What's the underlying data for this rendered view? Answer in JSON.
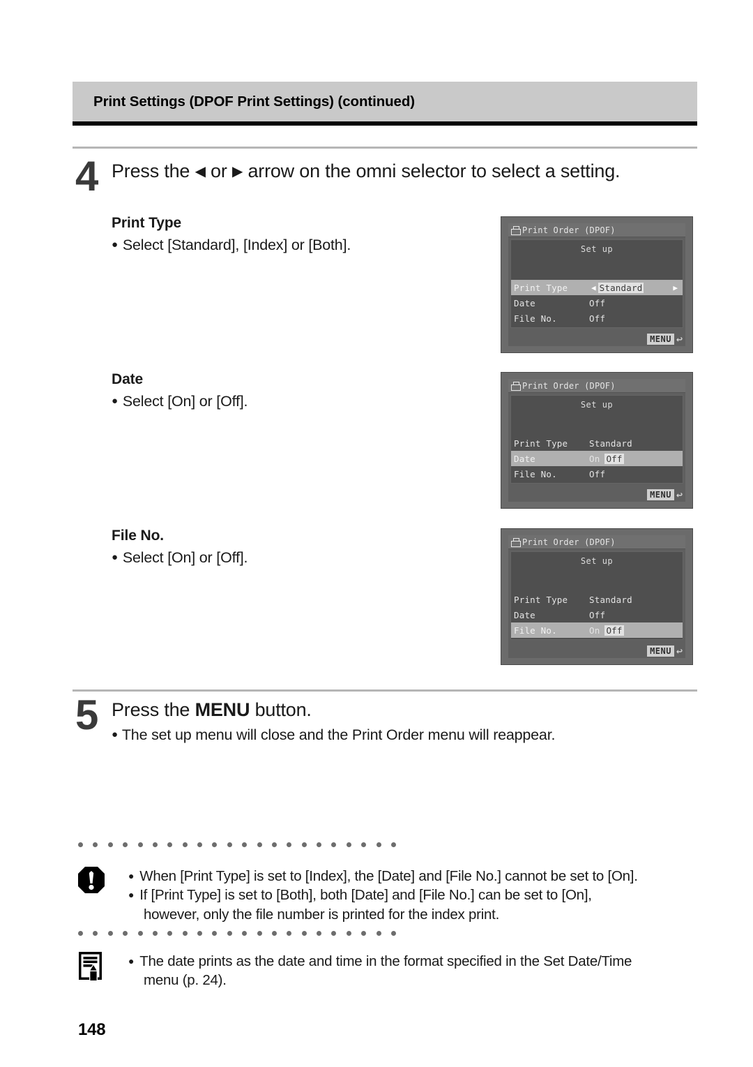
{
  "header": {
    "title": "Print Settings (DPOF Print Settings) (continued)"
  },
  "steps": [
    {
      "number": "4",
      "title_part1": "Press the ",
      "arrow_left": "◀",
      "title_part2": " or ",
      "arrow_right": "▶",
      "title_part3": " arrow on the omni selector to select a setting."
    },
    {
      "number": "5",
      "title_part1": "Press the ",
      "bold_word": "MENU",
      "title_part2": " button.",
      "bullet": "The set up menu will close and the Print Order menu will reappear."
    }
  ],
  "settings": [
    {
      "name": "Print Type",
      "desc": "Select [Standard], [Index] or [Both]."
    },
    {
      "name": "Date",
      "desc": "Select [On] or [Off]."
    },
    {
      "name": "File No.",
      "desc": "Select [On] or [Off]."
    }
  ],
  "lcd_screens": [
    {
      "title": "Print Order (DPOF)",
      "setup_label": "Set up",
      "menu_badge": "MENU",
      "return_glyph": "↩",
      "rows": [
        {
          "label": "Print Type",
          "value": "Standard",
          "selected": true,
          "show_arrows": true,
          "value_boxed": true,
          "arrow_left": "◀",
          "arrow_right": "▶"
        },
        {
          "label": "Date",
          "value": "Off",
          "selected": false,
          "show_arrows": false,
          "value_boxed": false
        },
        {
          "label": "File No.",
          "value": "Off",
          "selected": false,
          "show_arrows": false,
          "value_boxed": false
        }
      ]
    },
    {
      "title": "Print Order (DPOF)",
      "setup_label": "Set up",
      "menu_badge": "MENU",
      "return_glyph": "↩",
      "rows": [
        {
          "label": "Print Type",
          "value": "Standard",
          "selected": false,
          "show_arrows": false,
          "value_boxed": false
        },
        {
          "label": "Date",
          "value": "On",
          "value2": "Off",
          "selected": true,
          "show_arrows": false,
          "value_boxed": true
        },
        {
          "label": "File No.",
          "value": "Off",
          "selected": false,
          "show_arrows": false,
          "value_boxed": false
        }
      ]
    },
    {
      "title": "Print Order (DPOF)",
      "setup_label": "Set up",
      "menu_badge": "MENU",
      "return_glyph": "↩",
      "rows": [
        {
          "label": "Print Type",
          "value": "Standard",
          "selected": false,
          "show_arrows": false,
          "value_boxed": false
        },
        {
          "label": "Date",
          "value": "Off",
          "selected": false,
          "show_arrows": false,
          "value_boxed": false
        },
        {
          "label": "File No.",
          "value": "On",
          "value2": "Off",
          "selected": true,
          "show_arrows": false,
          "value_boxed": true
        }
      ]
    }
  ],
  "notes": {
    "warning": {
      "icon": "exclamation-octagon-icon",
      "bullets": [
        "When [Print Type] is set to [Index], the [Date] and [File No.] cannot be set to [On].",
        "If [Print Type] is set to [Both], both [Date] and [File No.] can be set to [On],",
        "however, only the file number is printed for the index print."
      ]
    },
    "info": {
      "icon": "notepad-pencil-icon",
      "bullets": [
        "The date prints as the date and time in the format specified in the Set Date/Time",
        "menu (p. 24)."
      ]
    }
  },
  "page_number": "148",
  "colors": {
    "header_bg": "#c9c9c9",
    "header_rule": "#000000",
    "thin_rule": "#b6b6b6",
    "lcd_bezel": "#6b6b6b",
    "lcd_panel": "#4f4f4f",
    "lcd_highlight": "#b0b0b0",
    "dot_gray": "#6d6d6d"
  }
}
